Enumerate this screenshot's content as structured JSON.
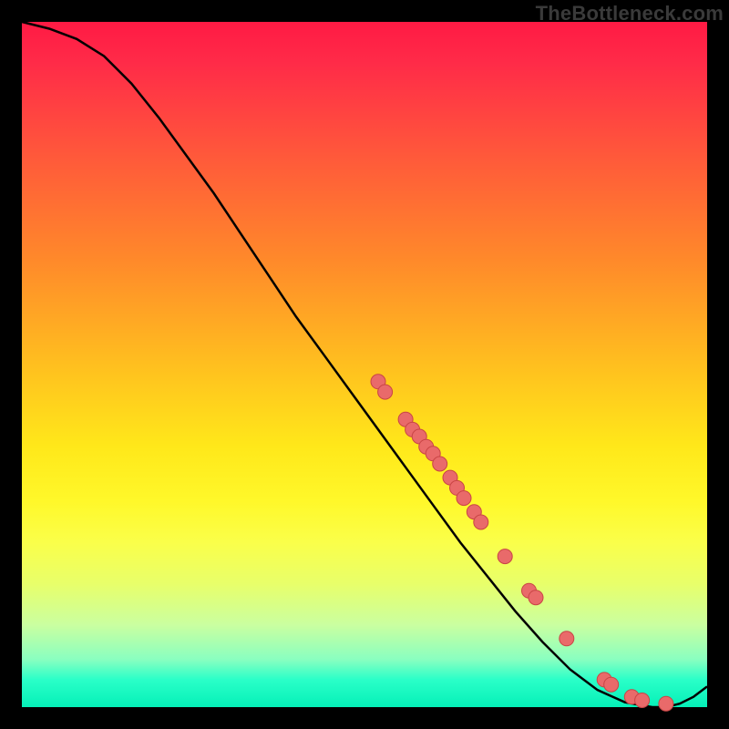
{
  "watermark": "TheBottleneck.com",
  "chart_data": {
    "type": "line",
    "title": "",
    "xlabel": "",
    "ylabel": "",
    "xlim": [
      0,
      100
    ],
    "ylim": [
      0,
      100
    ],
    "series": [
      {
        "name": "curve",
        "x": [
          0,
          4,
          8,
          12,
          16,
          20,
          24,
          28,
          32,
          36,
          40,
          44,
          48,
          52,
          56,
          60,
          64,
          68,
          72,
          76,
          80,
          84,
          88,
          92,
          94,
          96,
          98,
          100
        ],
        "y": [
          100,
          99,
          97.5,
          95,
          91,
          86,
          80.5,
          75,
          69,
          63,
          57,
          51.5,
          46,
          40.5,
          35,
          29.5,
          24,
          19,
          14,
          9.5,
          5.5,
          2.5,
          0.7,
          0,
          0,
          0.5,
          1.5,
          3
        ]
      }
    ],
    "points": [
      {
        "x": 52,
        "y": 47.5
      },
      {
        "x": 53,
        "y": 46
      },
      {
        "x": 56,
        "y": 42
      },
      {
        "x": 57,
        "y": 40.5
      },
      {
        "x": 58,
        "y": 39.5
      },
      {
        "x": 59,
        "y": 38
      },
      {
        "x": 60,
        "y": 37
      },
      {
        "x": 61,
        "y": 35.5
      },
      {
        "x": 62.5,
        "y": 33.5
      },
      {
        "x": 63.5,
        "y": 32
      },
      {
        "x": 64.5,
        "y": 30.5
      },
      {
        "x": 66,
        "y": 28.5
      },
      {
        "x": 67,
        "y": 27
      },
      {
        "x": 70.5,
        "y": 22
      },
      {
        "x": 74,
        "y": 17
      },
      {
        "x": 75,
        "y": 16
      },
      {
        "x": 79.5,
        "y": 10
      },
      {
        "x": 85,
        "y": 4
      },
      {
        "x": 86,
        "y": 3.3
      },
      {
        "x": 89,
        "y": 1.5
      },
      {
        "x": 90.5,
        "y": 1
      },
      {
        "x": 94,
        "y": 0.5
      }
    ],
    "colors": {
      "line": "#000000",
      "point_fill": "#e96a6a",
      "point_stroke": "#c94545"
    }
  }
}
